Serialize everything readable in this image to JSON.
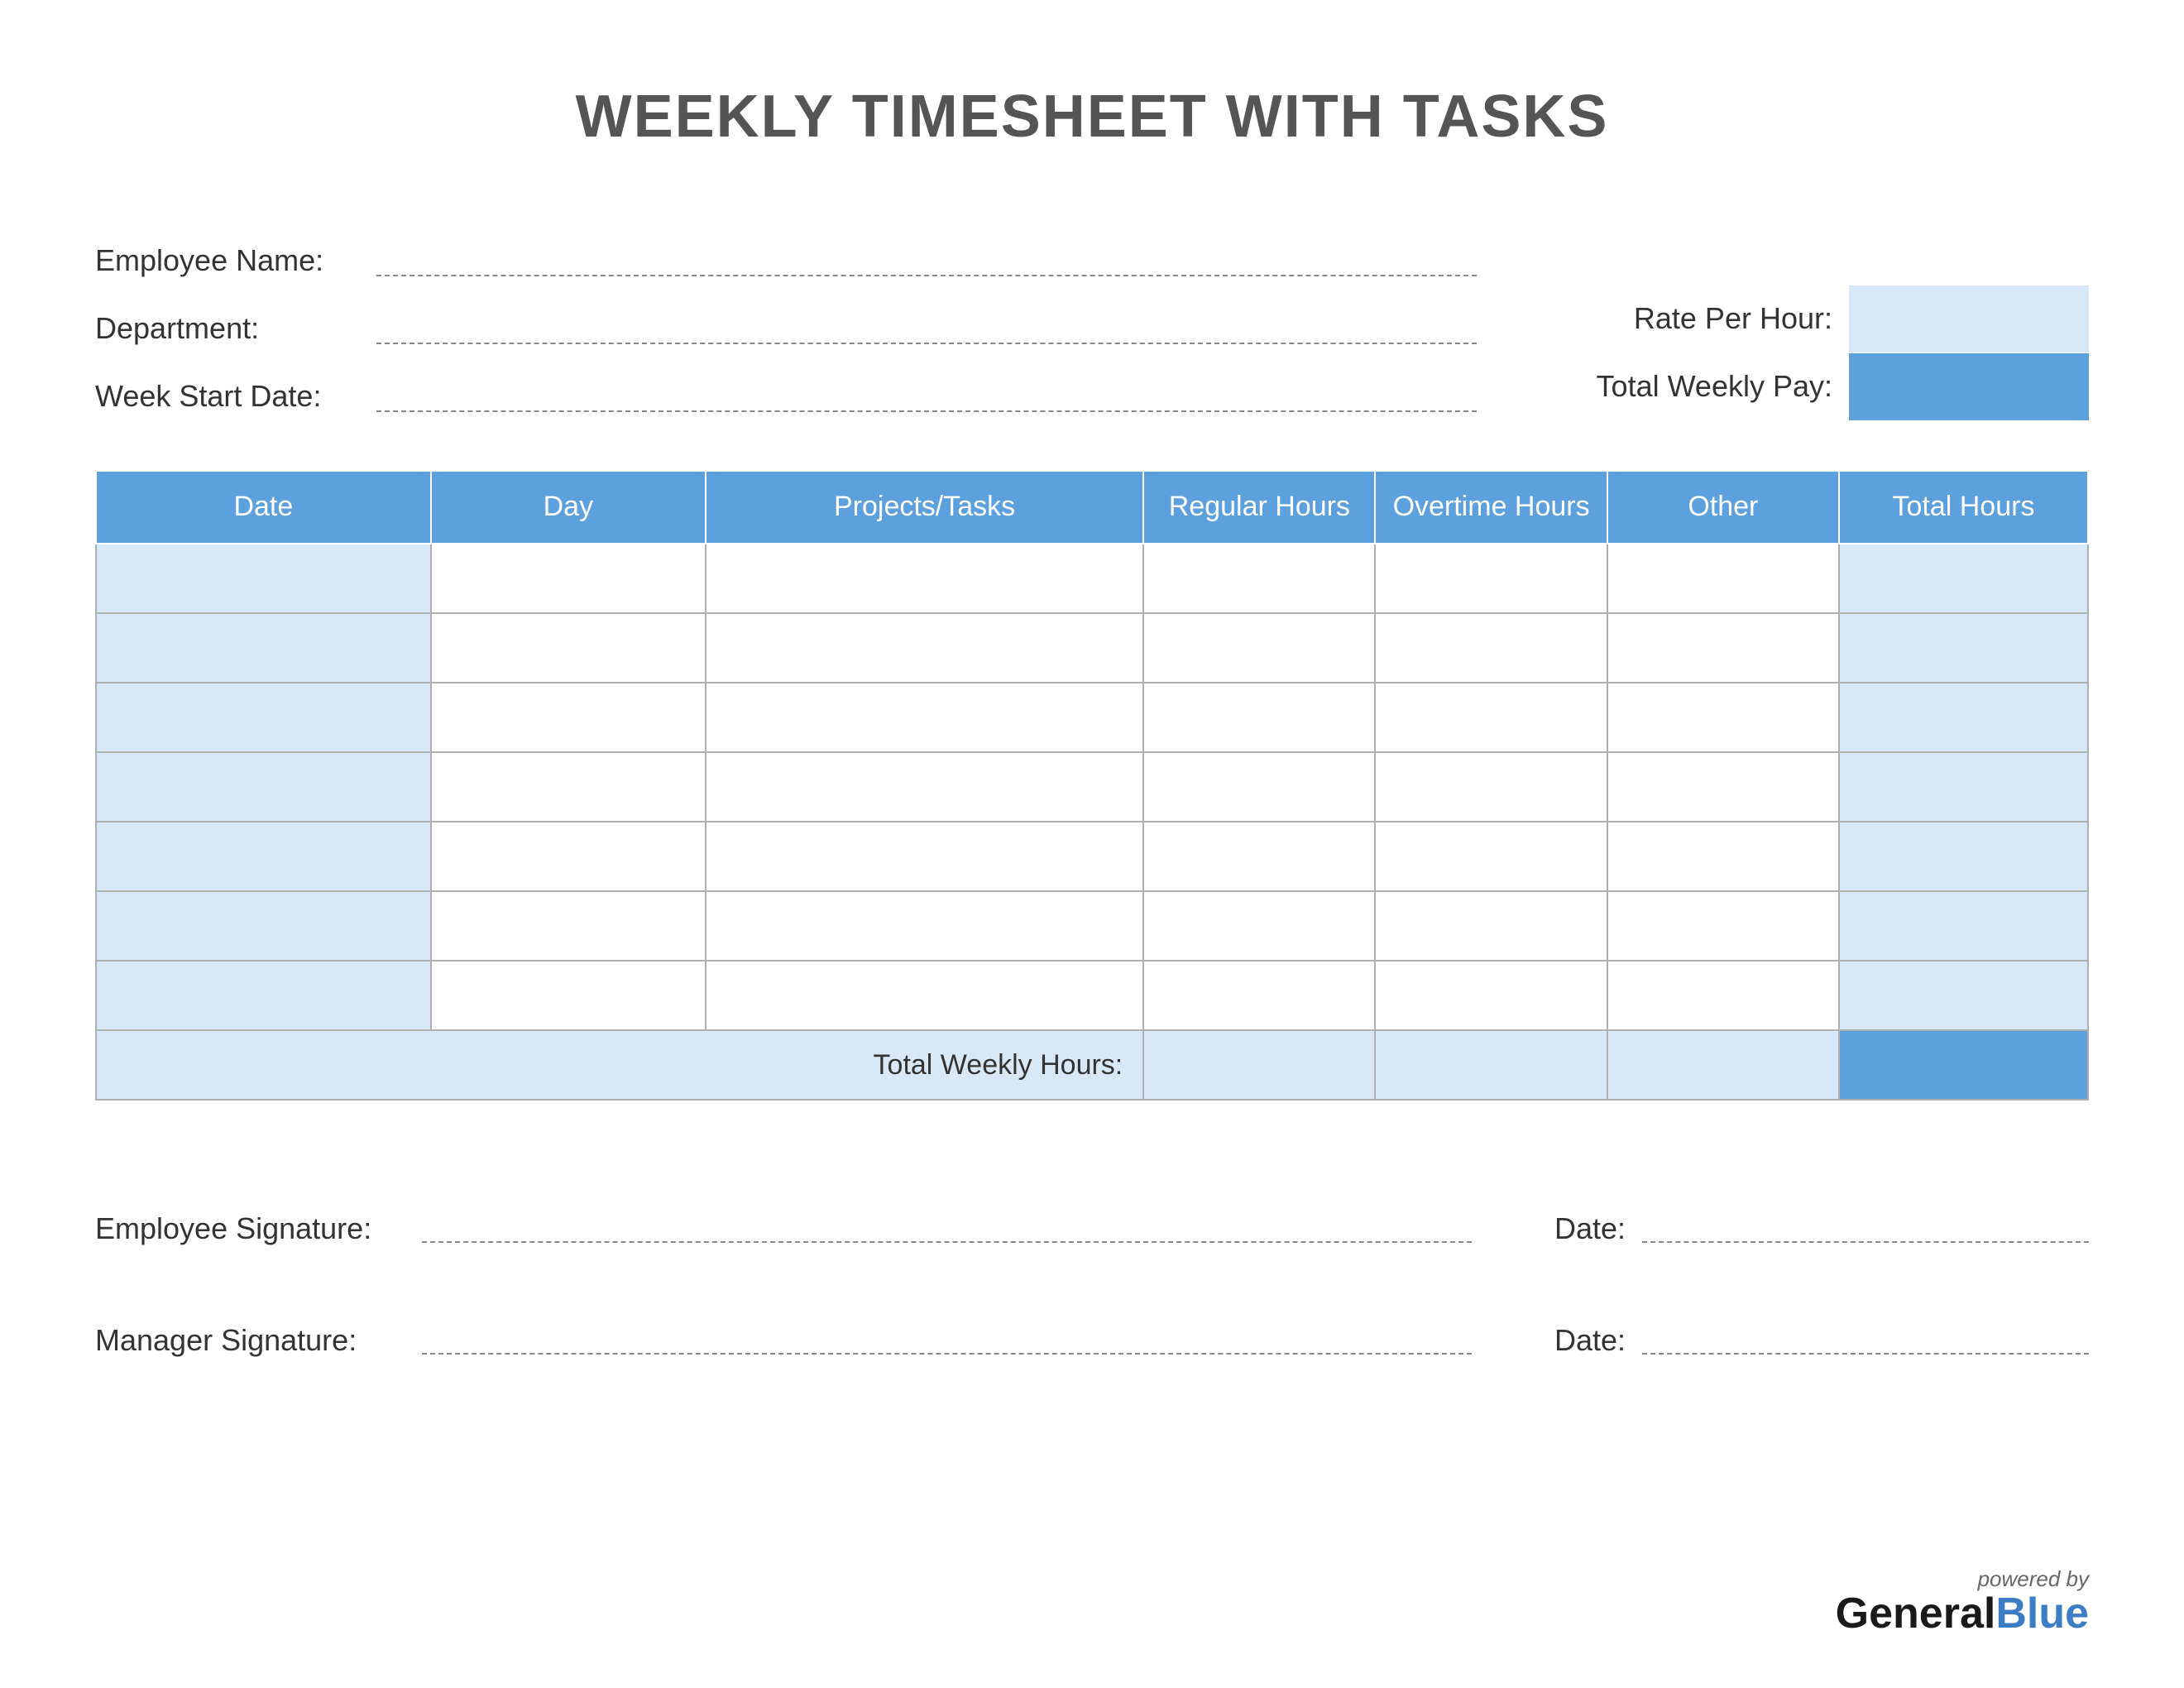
{
  "title": "WEEKLY TIMESHEET WITH TASKS",
  "info": {
    "employee_name_label": "Employee Name:",
    "department_label": "Department:",
    "week_start_label": "Week Start Date:",
    "rate_per_hour_label": "Rate Per Hour:",
    "total_weekly_pay_label": "Total Weekly Pay:",
    "employee_name": "",
    "department": "",
    "week_start": "",
    "rate_per_hour": "",
    "total_weekly_pay": ""
  },
  "table": {
    "headers": {
      "date": "Date",
      "day": "Day",
      "projects": "Projects/Tasks",
      "regular": "Regular Hours",
      "overtime": "Overtime Hours",
      "other": "Other",
      "total": "Total Hours"
    },
    "rows": [
      {
        "date": "",
        "day": "",
        "projects": "",
        "regular": "",
        "overtime": "",
        "other": "",
        "total": ""
      },
      {
        "date": "",
        "day": "",
        "projects": "",
        "regular": "",
        "overtime": "",
        "other": "",
        "total": ""
      },
      {
        "date": "",
        "day": "",
        "projects": "",
        "regular": "",
        "overtime": "",
        "other": "",
        "total": ""
      },
      {
        "date": "",
        "day": "",
        "projects": "",
        "regular": "",
        "overtime": "",
        "other": "",
        "total": ""
      },
      {
        "date": "",
        "day": "",
        "projects": "",
        "regular": "",
        "overtime": "",
        "other": "",
        "total": ""
      },
      {
        "date": "",
        "day": "",
        "projects": "",
        "regular": "",
        "overtime": "",
        "other": "",
        "total": ""
      },
      {
        "date": "",
        "day": "",
        "projects": "",
        "regular": "",
        "overtime": "",
        "other": "",
        "total": ""
      }
    ],
    "totals_label": "Total Weekly Hours:",
    "totals": {
      "regular": "",
      "overtime": "",
      "other": "",
      "grand": ""
    }
  },
  "signatures": {
    "employee_label": "Employee Signature:",
    "manager_label": "Manager Signature:",
    "date_label": "Date:"
  },
  "footer": {
    "powered_by": "powered by",
    "brand_part1": "General",
    "brand_part2": "Blue"
  },
  "colors": {
    "header_blue": "#5ca0dd",
    "light_blue": "#d8e8f6",
    "border_grey": "#aeb0b0"
  }
}
